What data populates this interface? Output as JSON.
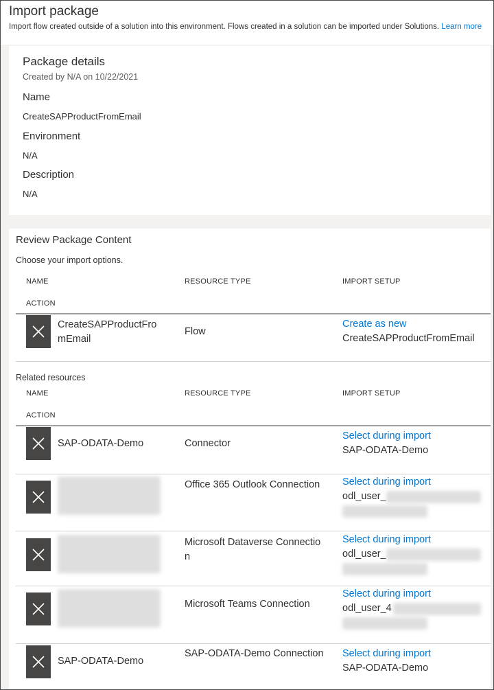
{
  "header": {
    "title": "Import package",
    "description": "Import flow created outside of a solution into this environment. Flows created in a solution can be imported under Solutions.",
    "learn_more": "Learn more"
  },
  "package_details": {
    "title": "Package details",
    "created": "Created by N/A on 10/22/2021",
    "name_label": "Name",
    "name_value": "CreateSAPProductFromEmail",
    "environment_label": "Environment",
    "environment_value": "N/A",
    "description_label": "Description",
    "description_value": "N/A"
  },
  "review": {
    "title": "Review Package Content",
    "subtitle": "Choose your import options.",
    "columns": {
      "name": "NAME",
      "resource_type": "RESOURCE TYPE",
      "import_setup": "IMPORT SETUP",
      "action": "ACTION"
    },
    "main_rows": [
      {
        "name": "CreateSAPProductFromEmail",
        "resource_type": "Flow",
        "setup_link": "Create as new",
        "setup_value": "CreateSAPProductFromEmail"
      }
    ],
    "related_label": "Related resources",
    "related_rows": [
      {
        "name": "SAP-ODATA-Demo",
        "resource_type": "Connector",
        "setup_link": "Select during import",
        "setup_value": "SAP-ODATA-Demo"
      },
      {
        "name": "",
        "resource_type": "Office 365 Outlook Connection",
        "setup_link": "Select during import",
        "setup_value": "odl_user_"
      },
      {
        "name": "",
        "resource_type": "Microsoft Dataverse Connection",
        "setup_link": "Select during import",
        "setup_value": "odl_user_"
      },
      {
        "name": "",
        "resource_type": "Microsoft Teams Connection",
        "setup_link": "Select during import",
        "setup_value": "odl_user_4"
      },
      {
        "name": "SAP-ODATA-Demo",
        "resource_type": "SAP-ODATA-Demo Connection",
        "setup_link": "Select during import",
        "setup_value": "SAP-ODATA-Demo"
      }
    ]
  },
  "icons": {
    "remove": "close-icon"
  },
  "colors": {
    "link": "#0078d4",
    "icon_button": "#484644",
    "panel_bg": "#f3f2f1"
  }
}
